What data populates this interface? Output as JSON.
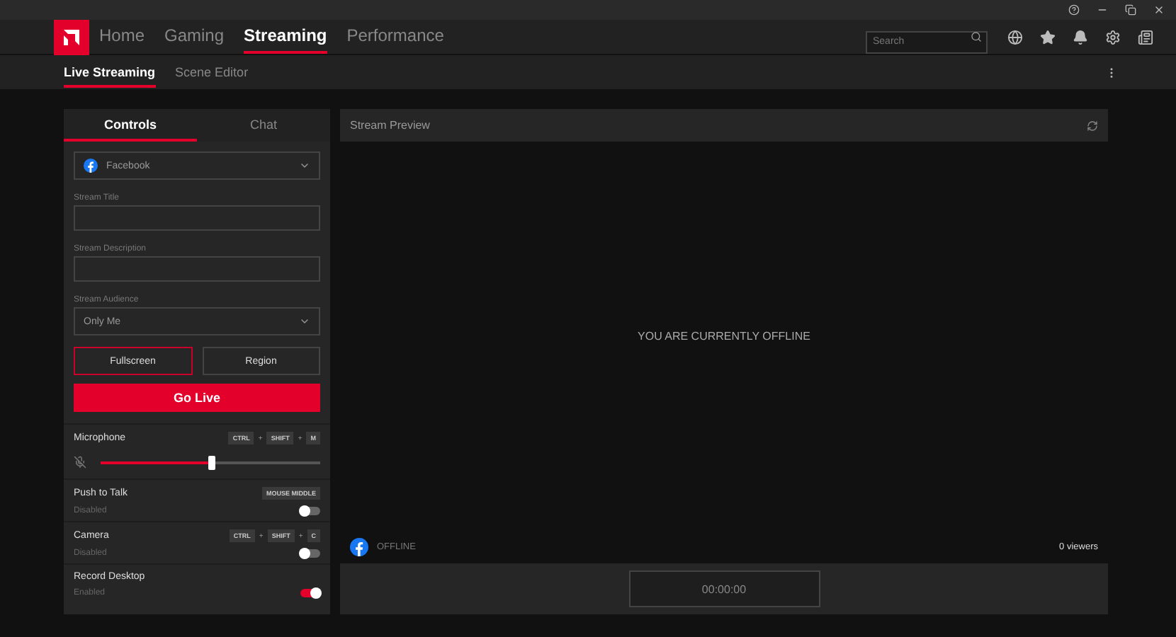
{
  "nav_tabs": [
    {
      "label": "Home",
      "selected": false
    },
    {
      "label": "Gaming",
      "selected": false
    },
    {
      "label": "Streaming",
      "selected": true
    },
    {
      "label": "Performance",
      "selected": false
    }
  ],
  "search": {
    "placeholder": "Search"
  },
  "sub_tabs": [
    {
      "label": "Live Streaming",
      "selected": true
    },
    {
      "label": "Scene Editor",
      "selected": false
    }
  ],
  "panel_tabs": [
    {
      "label": "Controls",
      "selected": true
    },
    {
      "label": "Chat",
      "selected": false
    }
  ],
  "platform": "Facebook",
  "fields": [
    {
      "label": "Stream Title"
    },
    {
      "label": "Stream Description"
    }
  ],
  "audience": {
    "label": "Stream Audience",
    "value": "Only Me"
  },
  "capture_modes": [
    {
      "label": "Fullscreen",
      "selected": true
    },
    {
      "label": "Region",
      "selected": false
    }
  ],
  "go_live": "Go Live",
  "settings": [
    {
      "kind": "slider",
      "title": "Microphone",
      "keys": [
        "CTRL",
        "SHIFT",
        "M"
      ],
      "joiner": "+",
      "level": 0.5
    },
    {
      "kind": "toggle",
      "title": "Push to Talk",
      "keys": [
        "MOUSE MIDDLE"
      ],
      "status": "Disabled",
      "on": false
    },
    {
      "kind": "toggle",
      "title": "Camera",
      "keys": [
        "CTRL",
        "SHIFT",
        "C"
      ],
      "joiner": "+",
      "status": "Disabled",
      "on": false
    },
    {
      "kind": "toggle",
      "title": "Record Desktop",
      "status": "Enabled",
      "on": true
    }
  ],
  "preview": {
    "title": "Stream Preview",
    "message": "YOU ARE CURRENTLY OFFLINE",
    "status": "OFFLINE",
    "viewers": "0 viewers",
    "timer": "00:00:00"
  }
}
